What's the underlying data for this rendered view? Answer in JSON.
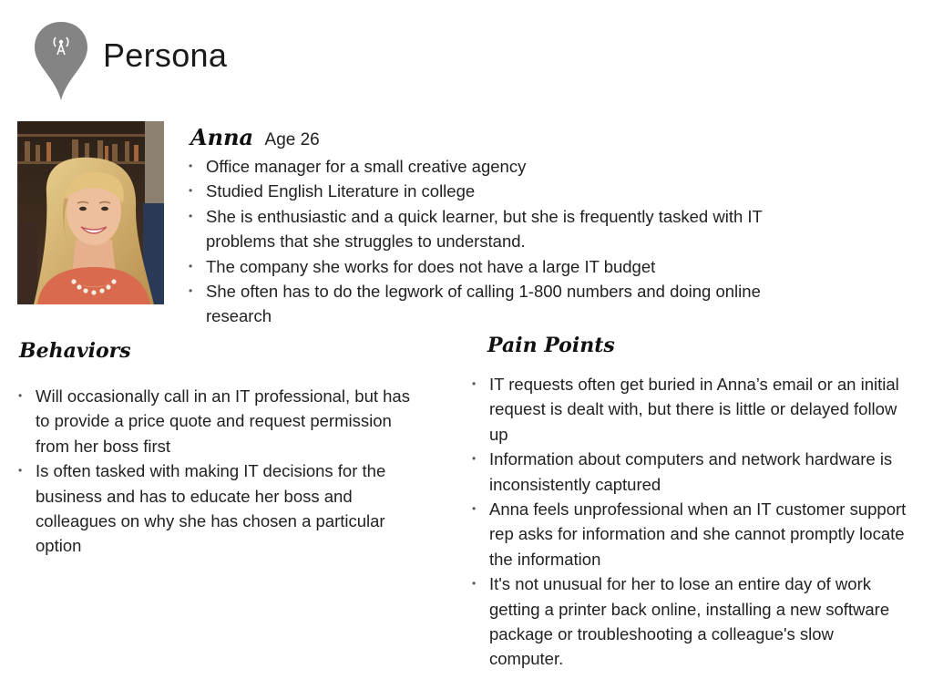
{
  "header": {
    "title": "Persona",
    "icon": "map-pin-icon"
  },
  "persona": {
    "photo": "portrait-photo",
    "name": "Anna",
    "age": "Age 26",
    "bio": [
      "Office manager for a small creative agency",
      "Studied English Literature in college",
      "She is enthusiastic and a quick learner, but she is frequently tasked with IT problems that she struggles to understand.",
      "The company she works for does not have a large IT budget",
      "She often has to do the legwork of calling 1-800 numbers and doing online research"
    ]
  },
  "behaviors": {
    "heading": "Behaviors",
    "items": [
      "Will occasionally call in an IT professional, but has to provide a price quote and request permission from her boss first",
      "Is often tasked with making IT decisions for the business and has to educate her boss and colleagues on why she has chosen a particular option"
    ]
  },
  "pain_points": {
    "heading": "Pain Points",
    "items": [
      "IT requests often get buried in Anna’s email or an initial request is dealt with, but there is little or delayed follow up",
      "Information about computers and network hardware is inconsistently captured",
      "Anna feels unprofessional when an IT customer support rep asks for information and she cannot promptly locate the information",
      "It's not unusual for her to lose an entire day of work getting a printer back online, installing a new software package or troubleshooting a colleague's slow computer."
    ]
  },
  "colors": {
    "pin": "#848484",
    "text": "#222222"
  }
}
